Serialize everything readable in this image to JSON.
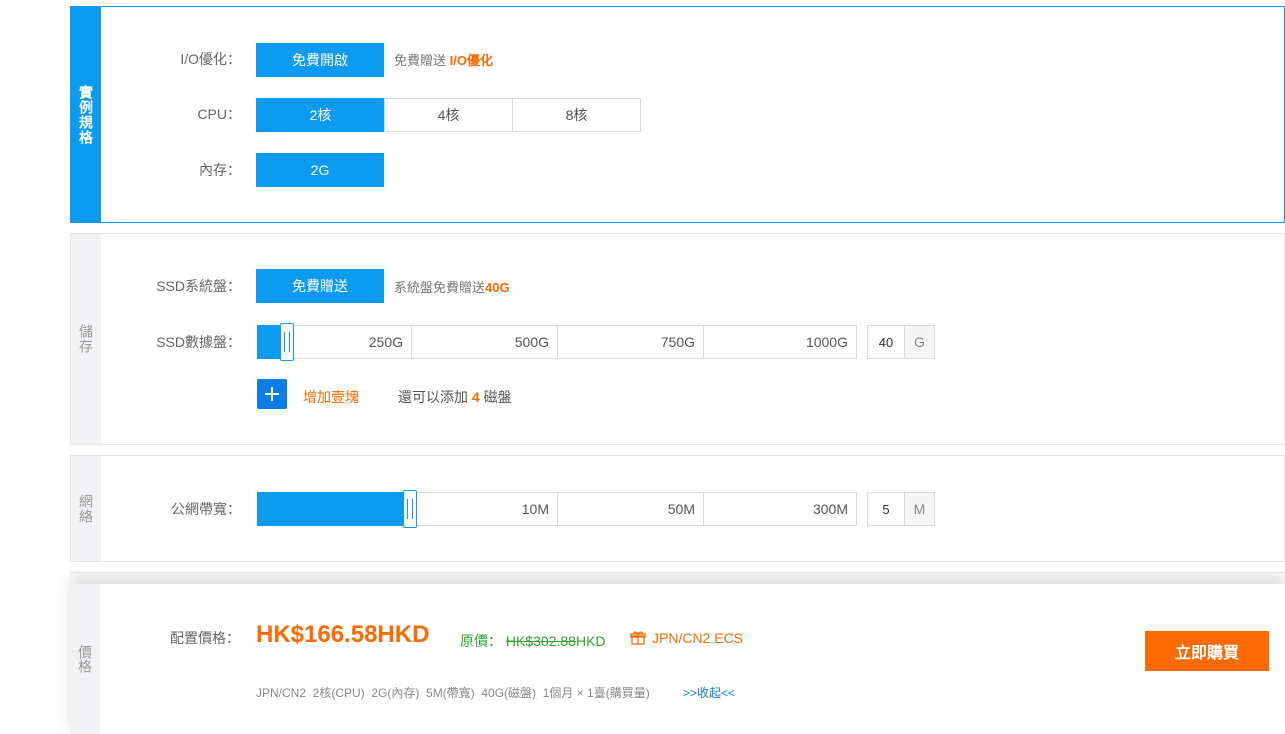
{
  "instance": {
    "section_label": "實例規格",
    "io": {
      "label": "I/O優化：",
      "option": "免費開啟",
      "note_prefix": "免費贈送",
      "note_highlight": "I/O優化"
    },
    "cpu": {
      "label": "CPU：",
      "options": [
        "2核",
        "4核",
        "8核"
      ],
      "selected": "2核"
    },
    "memory": {
      "label": "內存：",
      "option": "2G"
    }
  },
  "storage": {
    "section_label": "儲存",
    "system_disk": {
      "label": "SSD系統盤：",
      "option": "免費贈送",
      "note_prefix": "系統盤免費贈送",
      "note_highlight": "40G"
    },
    "data_disk": {
      "label": "SSD數據盤：",
      "ticks": [
        "250G",
        "500G",
        "750G",
        "1000G"
      ],
      "value": "40",
      "unit": "G",
      "level_fraction": 0.03
    },
    "add": {
      "label": "增加壹塊",
      "remaining_prefix": "還可以添加",
      "remaining_count": "4",
      "remaining_suffix": "磁盤"
    }
  },
  "network": {
    "section_label": "網絡",
    "bandwidth": {
      "label": "公網帶寬：",
      "ticks": [
        "10M",
        "50M",
        "300M"
      ],
      "value": "5",
      "unit": "M",
      "level_fraction": 0.255
    }
  },
  "price": {
    "section_label": "價格",
    "label": "配置價格：",
    "amount": "HK$166.58HKD",
    "original_label": "原價：",
    "original_amount": "HK$302.88",
    "original_currency": "HKD",
    "promo": "JPN/CN2 ECS",
    "summary": "JPN/CN2  2核(CPU)  2G(內存)  5M(帶寬)  40G(磁盤)  1個月 × 1臺(購買量)",
    "collapse": ">>收起<<",
    "buy_label": "立即購買"
  },
  "colors": {
    "accent": "#0d9bf2",
    "orange": "#ff6a00",
    "green": "#2fa32f"
  }
}
